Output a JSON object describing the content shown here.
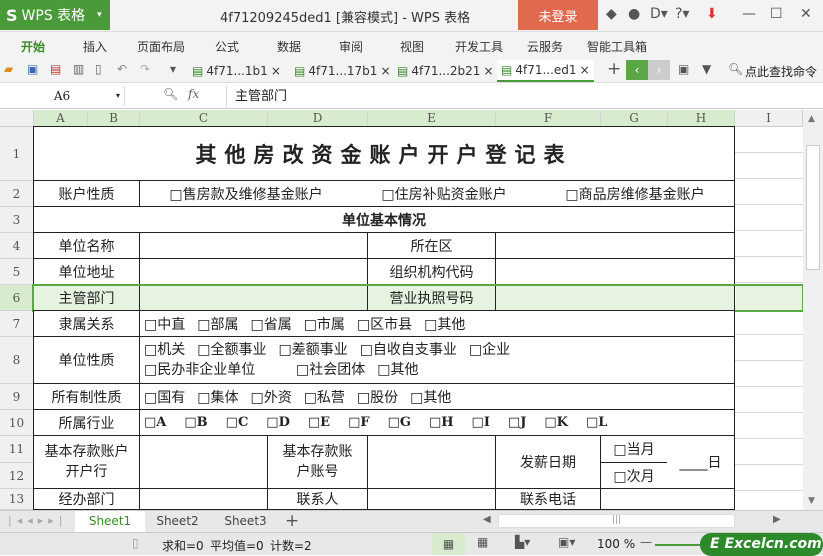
{
  "app": {
    "name": "WPS 表格",
    "title": "4f71209245ded1 [兼容模式] - WPS 表格",
    "login": "未登录"
  },
  "menu": [
    "开始",
    "插入",
    "页面布局",
    "公式",
    "数据",
    "审阅",
    "视图",
    "开发工具",
    "云服务",
    "智能工具箱"
  ],
  "doc_tabs": [
    "4f71...1b1",
    "4f71...17b1",
    "4f71...2b21",
    "4f71...ed1"
  ],
  "search_cmd": "点此查找命令",
  "name_box": "A6",
  "fx": "fx",
  "formula": "主管部门",
  "columns": [
    "A",
    "B",
    "C",
    "D",
    "E",
    "F",
    "G",
    "H",
    "I"
  ],
  "rows": [
    "1",
    "2",
    "3",
    "4",
    "5",
    "6",
    "7",
    "8",
    "9",
    "10",
    "11",
    "12",
    "13"
  ],
  "sheet": {
    "title": "其他房改资金账户开户登记表",
    "r2": {
      "label": "账户性质",
      "opts": [
        "□售房款及维修基金账户",
        "□住房补贴资金账户",
        "□商品房维修基金账户"
      ]
    },
    "r3": "单位基本情况",
    "r4": [
      "单位名称",
      "所在区"
    ],
    "r5": [
      "单位地址",
      "组织机构代码"
    ],
    "r6": [
      "主管部门",
      "营业执照号码"
    ],
    "r7": {
      "label": "隶属关系",
      "opts": [
        "□中直",
        "□部属",
        "□省属",
        "□市属",
        "□区市县",
        "□其他"
      ]
    },
    "r8": {
      "label": "单位性质",
      "line1": [
        "□机关",
        "□全额事业",
        "□差额事业",
        "□自收自支事业",
        "□企业"
      ],
      "line2": [
        "□民办非企业单位",
        "□社会团体",
        "□其他"
      ]
    },
    "r9": {
      "label": "所有制性质",
      "opts": [
        "□国有",
        "□集体",
        "□外资",
        "□私营",
        "□股份",
        "□其他"
      ]
    },
    "r10": {
      "label": "所属行业",
      "opts": [
        "□A",
        "□B",
        "□C",
        "□D",
        "□E",
        "□F",
        "□G",
        "□H",
        "□I",
        "□J",
        "□K",
        "□L"
      ]
    },
    "r11": {
      "bank": "基本存款账户开户行",
      "acct": "基本存款账户账号",
      "payday": "发薪日期",
      "cur": "□当月",
      "next": "□次月",
      "day": "____日"
    },
    "r13": [
      "经办部门",
      "联系人",
      "联系电话"
    ]
  },
  "sheets": [
    "Sheet1",
    "Sheet2",
    "Sheet3"
  ],
  "status": {
    "sum": "求和=0",
    "avg": "平均值=0",
    "count": "计数=2",
    "zoom": "100 %"
  },
  "watermark": "Excelcn.com"
}
